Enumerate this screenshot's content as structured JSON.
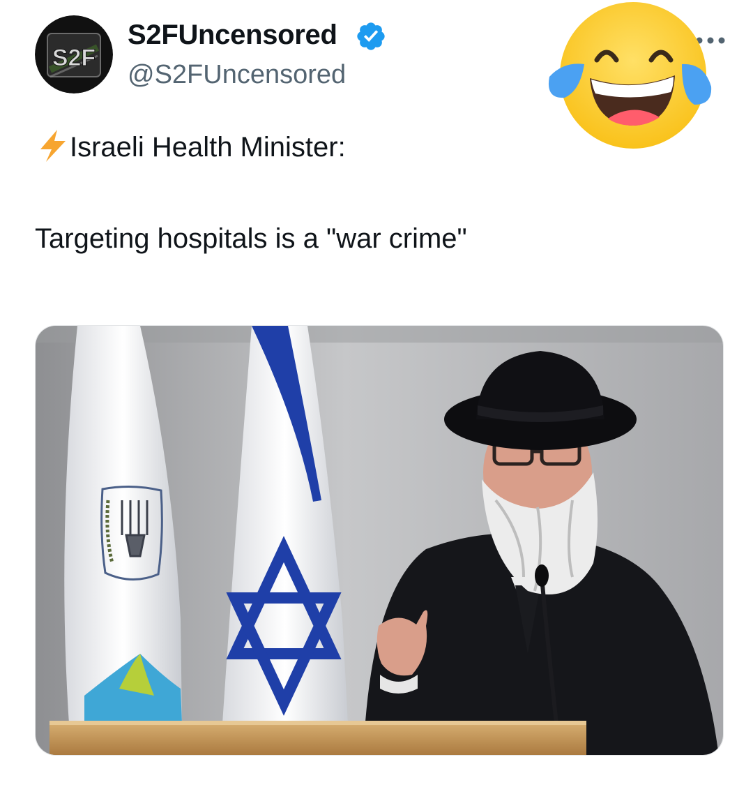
{
  "tweet": {
    "display_name": "S2FUncensored",
    "handle": "@S2FUncensored",
    "avatar_text": "S2F",
    "verified": true,
    "text_line1": "Israeli Health Minister:",
    "text_line2": "Targeting hospitals is a \"war crime\"",
    "lead_icon": "high-voltage-icon",
    "overlay_icon": "tears-of-joy-emoji",
    "more_icon": "more-options-icon"
  },
  "colors": {
    "verified_blue": "#1d9bf0",
    "text": "#0f1419",
    "secondary_text": "#536471",
    "emoji_yellow": "#fccf2f",
    "bolt_orange": "#f7a530",
    "flag_blue": "#1f3fa8"
  }
}
